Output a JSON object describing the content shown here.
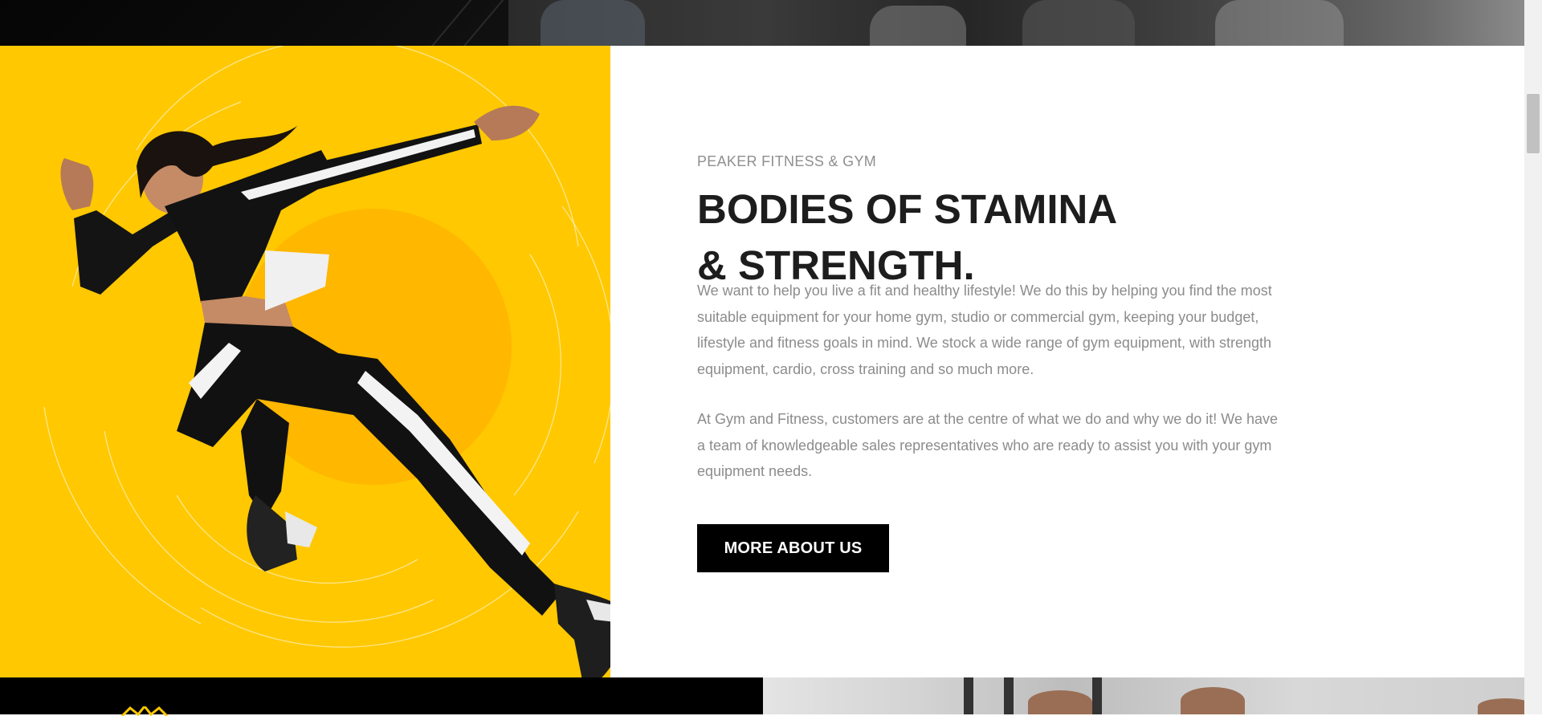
{
  "section": {
    "eyebrow": "PEAKER FITNESS & GYM",
    "headline_line1": "BODIES OF STAMINA",
    "headline_line2": "& STRENGTH.",
    "paragraph1": "We want to help you live a fit and healthy lifestyle! We do this by helping you find the most suitable equipment for your home gym, studio or commercial gym, keeping your budget, lifestyle and fitness goals in mind. We stock a wide range of gym equipment, with strength equipment, cardio, cross training and so much more.",
    "paragraph2": "At Gym and Fitness, customers are at the centre of what we do and why we do it! We have a team of knowledgeable sales representatives who are ready to assist you with your gym equipment needs.",
    "cta_label": "MORE ABOUT US"
  },
  "hero_image": {
    "subject": "woman-sprinting-photo"
  },
  "colors": {
    "accent_yellow": "#ffc800",
    "headline": "#1d1d1d",
    "body_text": "#8c8c8c",
    "button_bg": "#000000",
    "button_text": "#ffffff"
  },
  "icons": {
    "bottom_left": "crown-logo-icon"
  }
}
